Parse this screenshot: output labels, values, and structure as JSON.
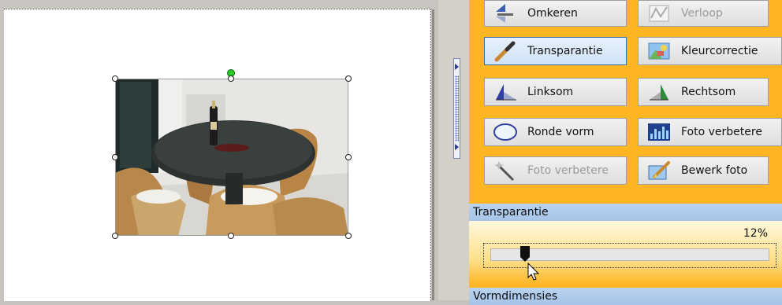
{
  "buttons": {
    "omkeren": "Omkeren",
    "verloop": "Verloop",
    "transparantie": "Transparantie",
    "kleurcorrectie": "Kleurcorrectie",
    "linksom": "Linksom",
    "rechtsom": "Rechtsom",
    "ronde_vorm": "Ronde vorm",
    "foto_verbeteren": "Foto verbetere",
    "foto_verbeteren_disabled": "Foto verbetere",
    "bewerk_foto": "Bewerk foto"
  },
  "sections": {
    "transparantie_title": "Transparantie",
    "vormdimensies_title": "Vormdimensies"
  },
  "transparency": {
    "value_label": "12%",
    "value": 0.12
  },
  "colors": {
    "panel_bg": "#fdb522",
    "section_header": "#b9d3ef",
    "selection_rotate_handle": "#22cc22"
  },
  "icons": [
    "flip-icon",
    "gradient-icon",
    "eyedropper-icon",
    "color-correction-icon",
    "rotate-left-icon",
    "rotate-right-icon",
    "ellipse-icon",
    "histogram-icon",
    "magic-wand-icon",
    "edit-photo-brush-icon",
    "cursor-icon"
  ]
}
